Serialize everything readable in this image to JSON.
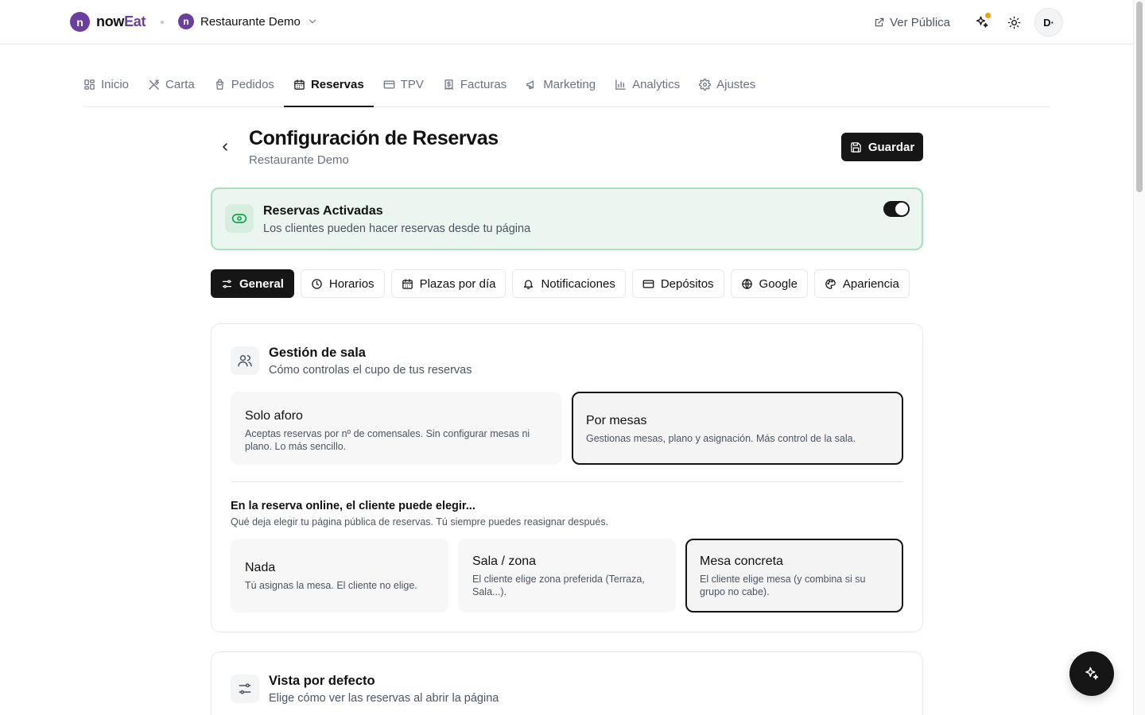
{
  "brand": {
    "name_part1": "now",
    "name_part2": "Eat",
    "logo_letter": "n"
  },
  "restaurant_selector": {
    "name": "Restaurante Demo",
    "logo_letter": "n"
  },
  "topbar": {
    "public_link_label": "Ver Pública",
    "avatar_initials": "D·"
  },
  "nav": {
    "tabs": [
      {
        "label": "Inicio",
        "icon": "grid-icon"
      },
      {
        "label": "Carta",
        "icon": "utensils-icon"
      },
      {
        "label": "Pedidos",
        "icon": "bag-icon"
      },
      {
        "label": "Reservas",
        "icon": "calendar-icon",
        "active": true
      },
      {
        "label": "TPV",
        "icon": "card-icon"
      },
      {
        "label": "Facturas",
        "icon": "receipt-icon"
      },
      {
        "label": "Marketing",
        "icon": "megaphone-icon"
      },
      {
        "label": "Analytics",
        "icon": "bar-chart-icon"
      },
      {
        "label": "Ajustes",
        "icon": "gear-icon"
      }
    ]
  },
  "header": {
    "title": "Configuración de Reservas",
    "subtitle": "Restaurante Demo",
    "save_label": "Guardar"
  },
  "banner": {
    "title": "Reservas Activadas",
    "description": "Los clientes pueden hacer reservas desde tu página",
    "enabled": true
  },
  "section_tabs": [
    {
      "label": "General",
      "icon": "sliders-icon",
      "active": true
    },
    {
      "label": "Horarios",
      "icon": "clock-icon"
    },
    {
      "label": "Plazas por día",
      "icon": "calendar-icon"
    },
    {
      "label": "Notificaciones",
      "icon": "bell-icon"
    },
    {
      "label": "Depósitos",
      "icon": "card-icon"
    },
    {
      "label": "Google",
      "icon": "globe-icon"
    },
    {
      "label": "Apariencia",
      "icon": "palette-icon"
    }
  ],
  "room_management": {
    "title": "Gestión de sala",
    "description": "Cómo controlas el cupo de tus reservas",
    "options": [
      {
        "title": "Solo aforo",
        "description": "Aceptas reservas por nº de comensales. Sin configurar mesas ni plano. Lo más sencillo.",
        "selected": false
      },
      {
        "title": "Por mesas",
        "description": "Gestionas mesas, plano y asignación. Más control de la sala.",
        "selected": true
      }
    ],
    "question": {
      "title": "En la reserva online, el cliente puede elegir...",
      "description": "Qué deja elegir tu página pública de reservas. Tú siempre puedes reasignar después.",
      "options": [
        {
          "title": "Nada",
          "description": "Tú asignas la mesa. El cliente no elige.",
          "selected": false
        },
        {
          "title": "Sala / zona",
          "description": "El cliente elige zona preferida (Terraza, Sala...).",
          "selected": false
        },
        {
          "title": "Mesa concreta",
          "description": "El cliente elige mesa (y combina si su grupo no cabe).",
          "selected": true
        }
      ]
    }
  },
  "default_view": {
    "title": "Vista por defecto",
    "description": "Elige cómo ver las reservas al abrir la página"
  },
  "colors": {
    "accent": "#6b3fa0",
    "primary": "#161616",
    "success_bg": "#eaf6ef",
    "success_border": "#a7dfc1",
    "notification": "#f59e0b"
  }
}
